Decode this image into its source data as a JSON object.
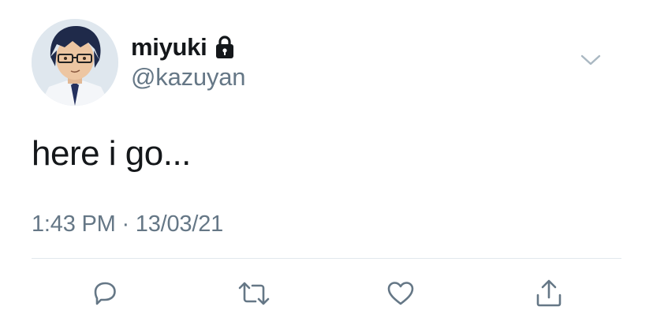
{
  "tweet": {
    "display_name": "miyuki",
    "handle": "@kazuyan",
    "text": "here i go...",
    "timestamp": "1:43 PM · 13/03/21",
    "protected": true
  },
  "icons": {
    "avatar": "avatar-image",
    "lock": "lock-icon",
    "menu": "chevron-down-icon",
    "reply": "reply-icon",
    "retweet": "retweet-icon",
    "like": "heart-icon",
    "share": "share-icon"
  },
  "colors": {
    "text_primary": "#14171a",
    "text_secondary": "#657786",
    "divider": "#e1e8ed",
    "icon": "#657786"
  }
}
